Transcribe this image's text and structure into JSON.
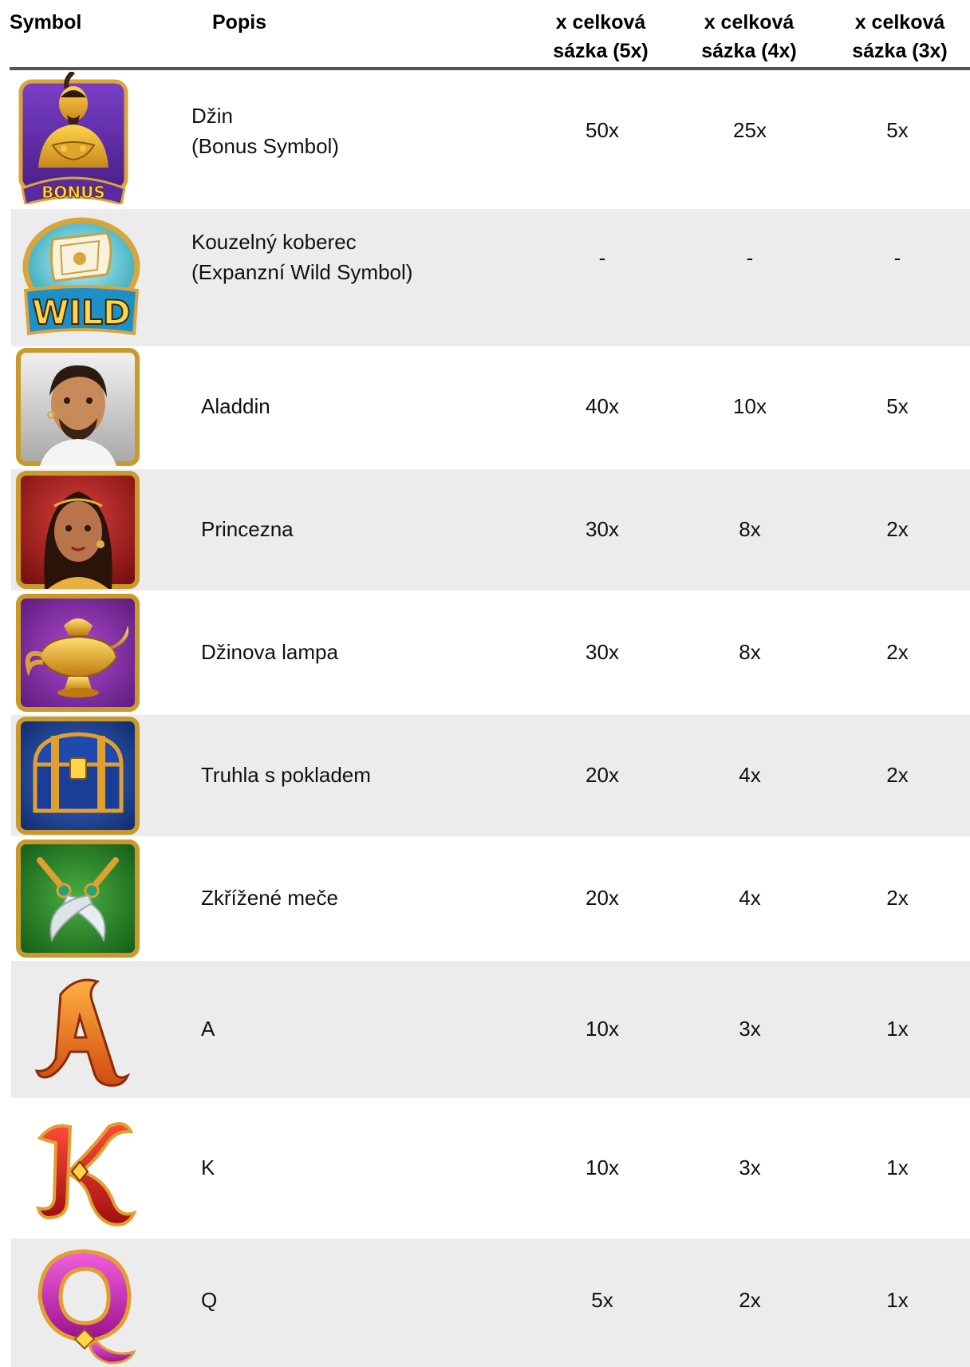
{
  "header": {
    "symbol": "Symbol",
    "popis": "Popis",
    "col1": "x celková sázka (5x)",
    "col2": "x celková sázka (4x)",
    "col3": "x celková sázka (3x)"
  },
  "rows": [
    {
      "icon": "genie-bonus-icon",
      "desc": "Džin\n(Bonus Symbol)",
      "v1": "50x",
      "v2": "25x",
      "v3": "5x"
    },
    {
      "icon": "magic-carpet-wild-icon",
      "desc": "Kouzelný koberec\n(Expanzní Wild Symbol)",
      "v1": "-",
      "v2": "-",
      "v3": "-"
    },
    {
      "icon": "aladdin-icon",
      "desc": "Aladdin",
      "v1": "40x",
      "v2": "10x",
      "v3": "5x"
    },
    {
      "icon": "princess-icon",
      "desc": "Princezna",
      "v1": "30x",
      "v2": "8x",
      "v3": "2x"
    },
    {
      "icon": "genie-lamp-icon",
      "desc": "Džinova lampa",
      "v1": "30x",
      "v2": "8x",
      "v3": "2x"
    },
    {
      "icon": "treasure-chest-icon",
      "desc": "Truhla s pokladem",
      "v1": "20x",
      "v2": "4x",
      "v3": "2x"
    },
    {
      "icon": "crossed-swords-icon",
      "desc": "Zkřížené meče",
      "v1": "20x",
      "v2": "4x",
      "v3": "2x"
    },
    {
      "icon": "letter-a-icon",
      "desc": "A",
      "v1": "10x",
      "v2": "3x",
      "v3": "1x"
    },
    {
      "icon": "letter-k-icon",
      "desc": "K",
      "v1": "10x",
      "v2": "3x",
      "v3": "1x"
    },
    {
      "icon": "letter-q-icon",
      "desc": "Q",
      "v1": "5x",
      "v2": "2x",
      "v3": "1x"
    }
  ],
  "icon_texts": {
    "bonus": "BONUS",
    "wild": "WILD"
  },
  "colors": {
    "shade": "#ececec",
    "rule": "#555555"
  }
}
